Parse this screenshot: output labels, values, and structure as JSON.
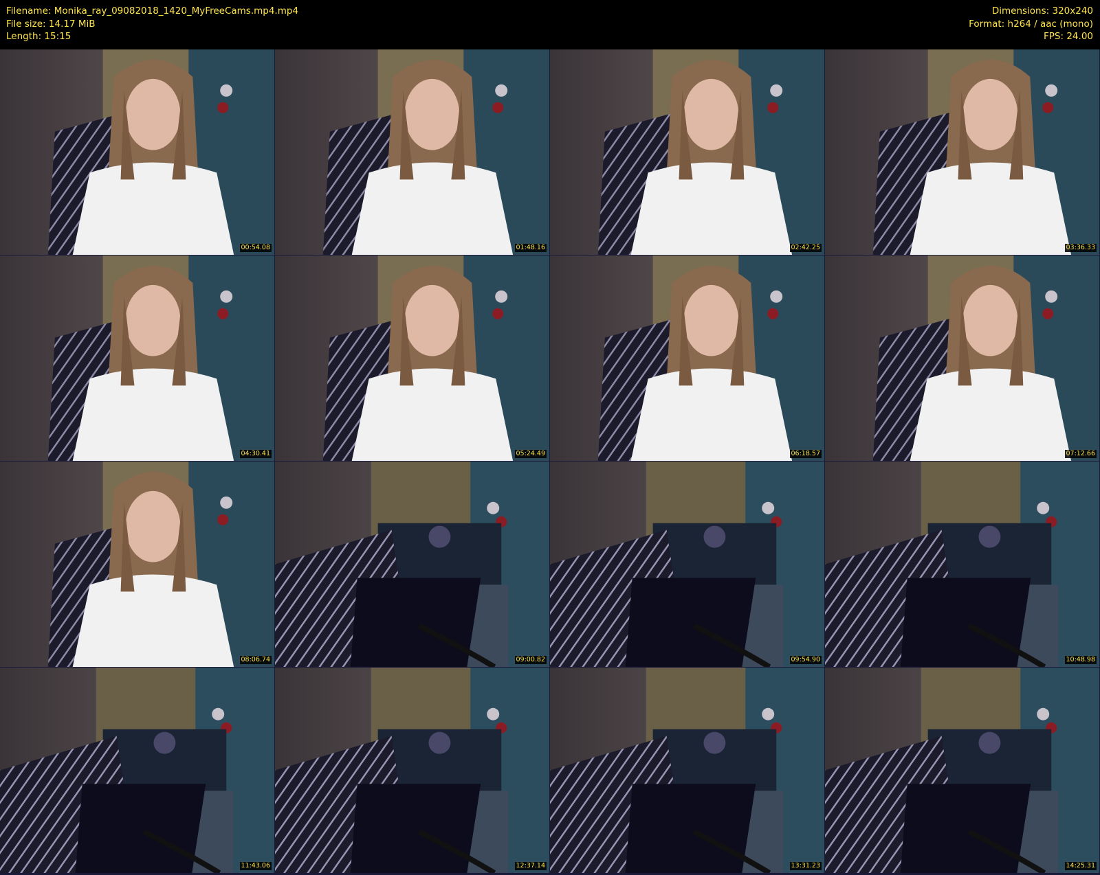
{
  "header": {
    "filename": "Filename: Monika_ray_09082018_1420_MyFreeCams.mp4.mp4",
    "filesize": "File size: 14.17 MiB",
    "length": "Length: 15:15",
    "dimensions": "Dimensions: 320x240",
    "format": "Format: h264 / aac (mono)",
    "fps": "FPS: 24.00"
  },
  "colors": {
    "text_accent": "#ffe44d",
    "background": "#000000"
  },
  "thumbnails": [
    {
      "time": "00:54.08",
      "scene": "person"
    },
    {
      "time": "01:48.16",
      "scene": "person"
    },
    {
      "time": "02:42.25",
      "scene": "person"
    },
    {
      "time": "03:36.33",
      "scene": "person"
    },
    {
      "time": "04:30.41",
      "scene": "person"
    },
    {
      "time": "05:24.49",
      "scene": "person"
    },
    {
      "time": "06:18.57",
      "scene": "person"
    },
    {
      "time": "07:12.66",
      "scene": "person"
    },
    {
      "time": "08:06.74",
      "scene": "person"
    },
    {
      "time": "09:00.82",
      "scene": "empty-room"
    },
    {
      "time": "09:54.90",
      "scene": "empty-room"
    },
    {
      "time": "10:48.98",
      "scene": "empty-room"
    },
    {
      "time": "11:43.06",
      "scene": "empty-room"
    },
    {
      "time": "12:37.14",
      "scene": "empty-room"
    },
    {
      "time": "13:31.23",
      "scene": "empty-room"
    },
    {
      "time": "14:25.31",
      "scene": "empty-room"
    }
  ]
}
